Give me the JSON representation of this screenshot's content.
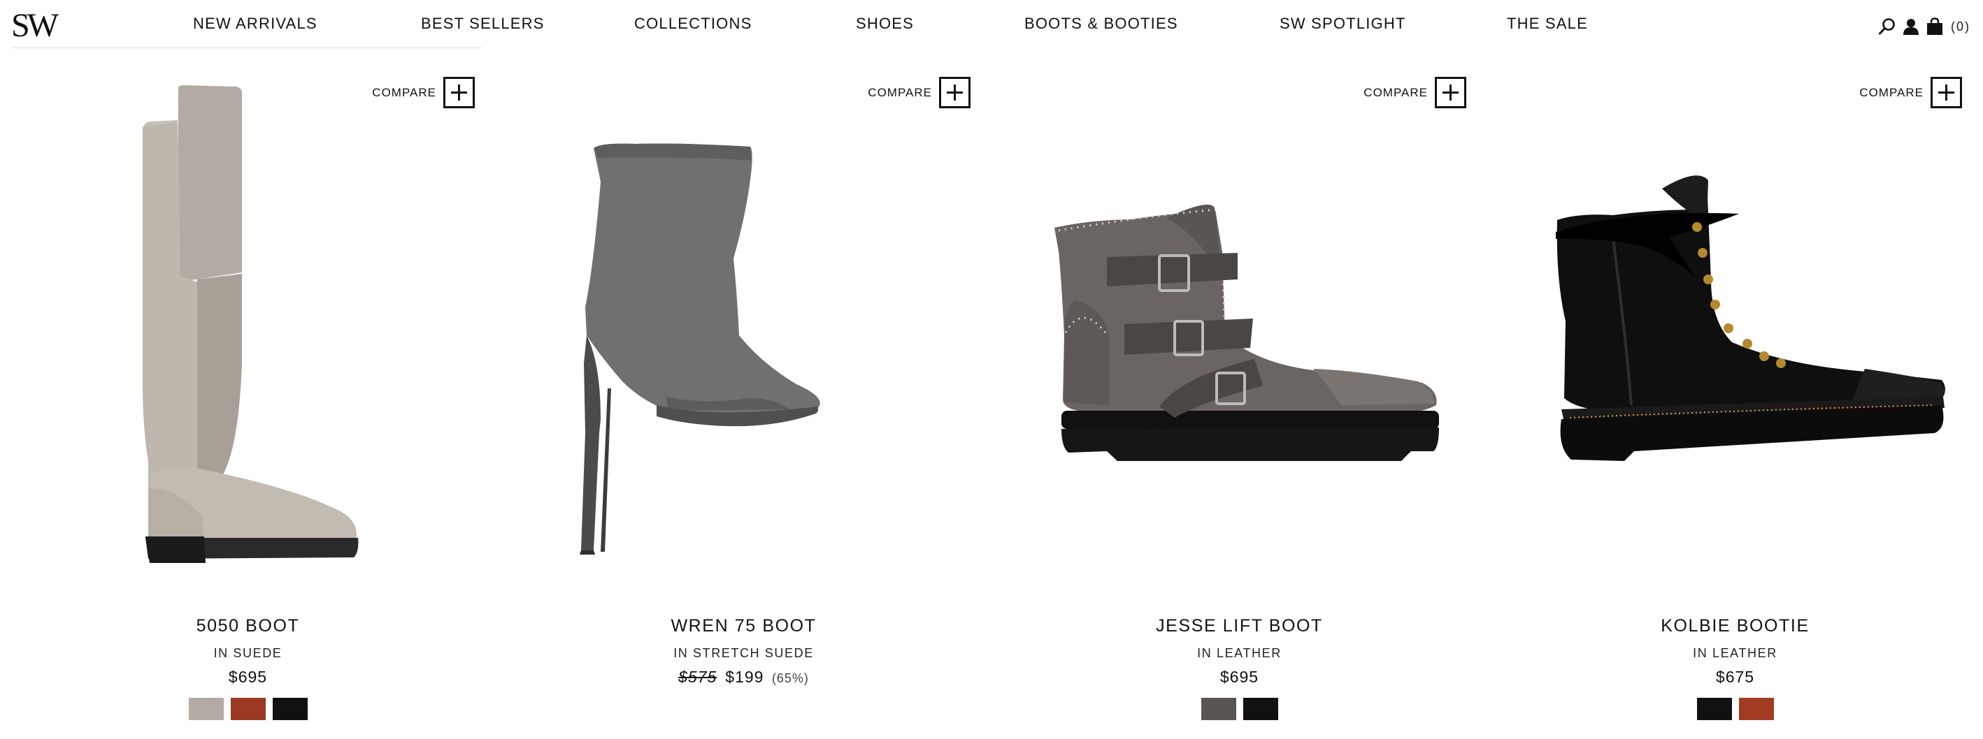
{
  "header": {
    "logo_text": "SW",
    "nav": [
      {
        "label": "NEW ARRIVALS"
      },
      {
        "label": "BEST SELLERS"
      },
      {
        "label": "COLLECTIONS"
      },
      {
        "label": "SHOES"
      },
      {
        "label": "BOOTS & BOOTIES"
      },
      {
        "label": "SW SPOTLIGHT"
      },
      {
        "label": "THE SALE"
      }
    ],
    "icons": [
      "search-icon",
      "account-icon",
      "shopping-bag-icon"
    ],
    "bag_count": "(0)"
  },
  "products": [
    {
      "compare_label": "COMPARE",
      "name": "5050 BOOT",
      "material": "IN SUEDE",
      "price": "$695",
      "swatches": [
        "#b3aba3",
        "#9c3a24",
        "#111111"
      ]
    },
    {
      "compare_label": "COMPARE",
      "name": "WREN 75 BOOT",
      "material": "IN STRETCH SUEDE",
      "original_price": "$575",
      "price": "$199",
      "discount": "(65%)",
      "swatches": []
    },
    {
      "compare_label": "COMPARE",
      "name": "JESSE LIFT BOOT",
      "material": "IN LEATHER",
      "price": "$695",
      "swatches": [
        "#5a5552",
        "#111111"
      ]
    },
    {
      "compare_label": "COMPARE",
      "name": "KOLBIE BOOTIE",
      "material": "IN LEATHER",
      "price": "$675",
      "swatches": [
        "#111111",
        "#a13c22"
      ]
    }
  ]
}
